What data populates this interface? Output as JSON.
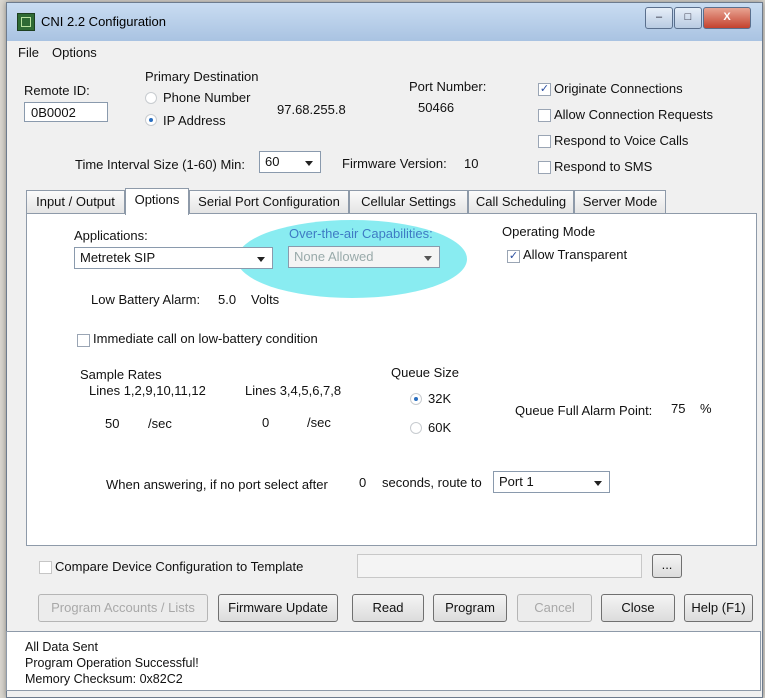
{
  "window": {
    "title": "CNI 2.2 Configuration",
    "controls": {
      "minimize": "–",
      "maximize": "□",
      "close": "X"
    }
  },
  "menu": {
    "file": "File",
    "options": "Options"
  },
  "header": {
    "remote_id_label": "Remote ID:",
    "remote_id_value": "0B0002",
    "primary_destination_label": "Primary Destination",
    "phone_number_label": "Phone Number",
    "ip_address_label": "IP Address",
    "selected_destination": "IP Address",
    "ip_value": "97.68.255.8",
    "port_number_label": "Port Number:",
    "port_number_value": "50466",
    "time_interval_label": "Time Interval Size (1-60) Min:",
    "time_interval_value": "60",
    "firmware_version_label": "Firmware Version:",
    "firmware_version_value": "10",
    "checks": [
      {
        "label": "Originate Connections",
        "checked": true
      },
      {
        "label": "Allow Connection Requests",
        "checked": false
      },
      {
        "label": "Respond to Voice Calls",
        "checked": false
      },
      {
        "label": "Respond to SMS",
        "checked": false
      }
    ]
  },
  "tabs": [
    {
      "label": "Input / Output"
    },
    {
      "label": "Options",
      "active": true
    },
    {
      "label": "Serial Port Configuration"
    },
    {
      "label": "Cellular Settings"
    },
    {
      "label": "Call Scheduling"
    },
    {
      "label": "Server Mode"
    }
  ],
  "options_tab": {
    "applications_label": "Applications:",
    "applications_value": "Metretek SIP",
    "ota_label": "Over-the-air Capabilities:",
    "ota_value": "None Allowed",
    "operating_mode_label": "Operating Mode",
    "allow_transparent_label": "Allow Transparent",
    "allow_transparent_checked": true,
    "low_battery_label": "Low Battery Alarm:",
    "low_battery_value": "5.0",
    "low_battery_unit": "Volts",
    "immediate_call_label": "Immediate call on low-battery condition",
    "sample_rates_label": "Sample Rates",
    "lines_a_label": "Lines 1,2,9,10,11,12",
    "lines_b_label": "Lines 3,4,5,6,7,8",
    "rate_a_value": "50",
    "rate_b_value": "0",
    "rate_unit": "/sec",
    "queue_size_label": "Queue Size",
    "queue_32k": "32K",
    "queue_60k": "60K",
    "queue_selected": "32K",
    "queue_alarm_label": "Queue Full Alarm Point:",
    "queue_alarm_value": "75",
    "queue_alarm_unit": "%",
    "answer_prefix": "When answering, if no port select after",
    "answer_seconds": "0",
    "answer_suffix": "seconds, route to",
    "route_port_value": "Port 1"
  },
  "compare": {
    "label": "Compare Device Configuration to Template",
    "browse_label": "..."
  },
  "buttons": {
    "program_accounts": "Program Accounts / Lists",
    "firmware_update": "Firmware Update",
    "read": "Read",
    "program": "Program",
    "cancel": "Cancel",
    "close": "Close",
    "help": "Help (F1)"
  },
  "status": {
    "lines": [
      "All Data Sent",
      "Program Operation Successful!",
      "Memory Checksum: 0x82C2"
    ]
  },
  "colors": {
    "highlight": "#28dce6",
    "accent": "#2b6fc0"
  }
}
